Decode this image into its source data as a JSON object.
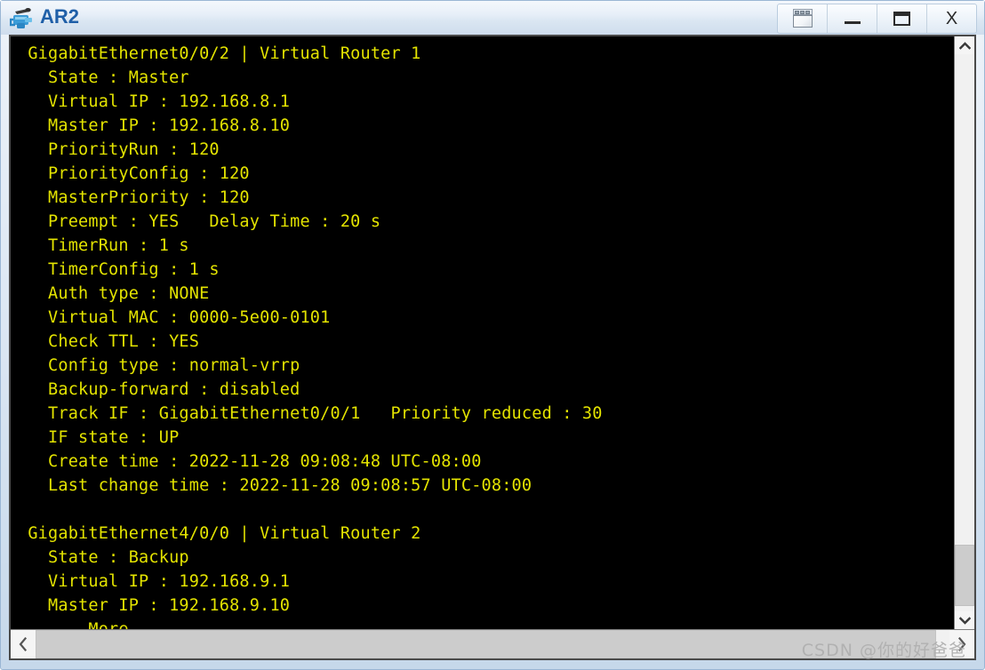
{
  "window": {
    "title": "AR2",
    "icon": "router-icon",
    "controls": [
      {
        "name": "restore-window-button",
        "glyph": "",
        "icon": "restore-icon"
      },
      {
        "name": "minimize-button",
        "glyph": "—",
        "icon": "minimize-icon"
      },
      {
        "name": "maximize-button",
        "glyph": "",
        "icon": "maximize-icon"
      },
      {
        "name": "close-button",
        "glyph": "X",
        "icon": "close-icon"
      }
    ]
  },
  "terminal": {
    "foreground_color": "#e3e300",
    "background_color": "#000000",
    "lines": [
      " GigabitEthernet0/0/2 | Virtual Router 1",
      "   State : Master",
      "   Virtual IP : 192.168.8.1",
      "   Master IP : 192.168.8.10",
      "   PriorityRun : 120",
      "   PriorityConfig : 120",
      "   MasterPriority : 120",
      "   Preempt : YES   Delay Time : 20 s",
      "   TimerRun : 1 s",
      "   TimerConfig : 1 s",
      "   Auth type : NONE",
      "   Virtual MAC : 0000-5e00-0101",
      "   Check TTL : YES",
      "   Config type : normal-vrrp",
      "   Backup-forward : disabled",
      "   Track IF : GigabitEthernet0/0/1   Priority reduced : 30",
      "   IF state : UP",
      "   Create time : 2022-11-28 09:08:48 UTC-08:00",
      "   Last change time : 2022-11-28 09:08:57 UTC-08:00",
      "",
      " GigabitEthernet4/0/0 | Virtual Router 2",
      "   State : Backup",
      "   Virtual IP : 192.168.9.1",
      "   Master IP : 192.168.9.10",
      "  ---- More ----"
    ]
  },
  "scrollbars": {
    "vertical": {
      "up_glyph": "▲",
      "down_glyph": "▼",
      "thumb_top_pct": "88%",
      "thumb_height_pct": "11%"
    },
    "horizontal": {
      "left_glyph": "‹",
      "right_glyph": "›",
      "thumb_width_pct": "98.5%"
    }
  },
  "watermark": {
    "text": "CSDN @你的好爸爸"
  }
}
